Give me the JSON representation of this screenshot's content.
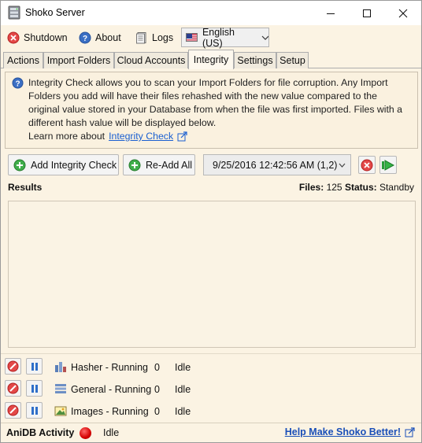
{
  "window": {
    "title": "Shoko Server",
    "icons": [
      "app-icon",
      "minimize-icon",
      "maximize-icon",
      "close-icon"
    ]
  },
  "toolbar": {
    "shutdown_label": "Shutdown",
    "about_label": "About",
    "logs_label": "Logs",
    "language_selected": "English (US)"
  },
  "tabs": [
    {
      "label": "Actions"
    },
    {
      "label": "Import Folders"
    },
    {
      "label": "Cloud Accounts"
    },
    {
      "label": "Integrity",
      "active": true
    },
    {
      "label": "Settings"
    },
    {
      "label": "Setup"
    }
  ],
  "info": {
    "text": "Integrity Check allows you to scan your Import Folders for file corruption. Any Import Folders you add will have their files rehashed with the new value compared to the original value stored in your Database from when the file was first imported. Files with a different hash value will be displayed below.",
    "learn_more_prefix": "Learn more about",
    "learn_more_link": "Integrity Check"
  },
  "actions": {
    "add_label": "Add Integrity Check",
    "readd_label": "Re-Add All",
    "selected_check": "9/25/2016 12:42:56 AM (1,2)"
  },
  "results": {
    "label": "Results",
    "files_label": "Files:",
    "files_value": "125",
    "status_label": "Status:",
    "status_value": "Standby"
  },
  "queues": [
    {
      "name": "Hasher - Running",
      "count": "0",
      "state": "Idle"
    },
    {
      "name": "General - Running",
      "count": "0",
      "state": "Idle"
    },
    {
      "name": "Images - Running",
      "count": "0",
      "state": "Idle"
    }
  ],
  "status": {
    "anidb_label": "AniDB Activity",
    "anidb_state": "Idle",
    "help_link": "Help Make Shoko Better!"
  },
  "colors": {
    "background": "#fbf3e3",
    "link": "#1a5fd1",
    "stop_red": "#d42a2a",
    "pause_blue": "#2f6fc9",
    "play_green": "#2a9d3a"
  }
}
